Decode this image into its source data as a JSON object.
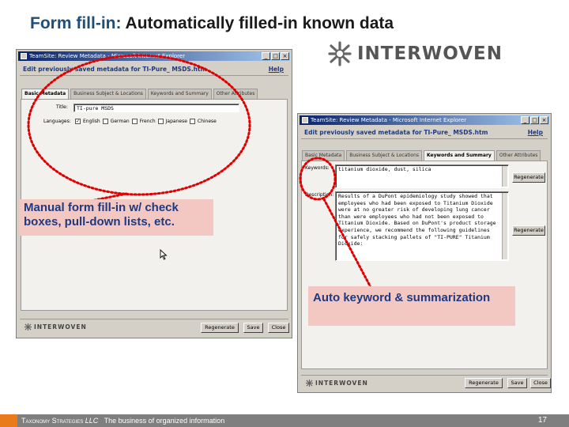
{
  "slide": {
    "title_prefix": "Form fill-in:",
    "title_main": "Automatically filled-in known data",
    "logo_text": "INTERWOVEN"
  },
  "window1": {
    "titlebar": "TeamSite: Review Metadata - Microsoft Internet Explorer",
    "header": "Edit previously saved metadata for TI-Pure_ MSDS.htm",
    "help": "Help",
    "tabs": [
      "Basic Metadata",
      "Business Subject & Locations",
      "Keywords and Summary",
      "Other Attributes"
    ],
    "title_label": "Title:",
    "title_value": "TI-pure MSDS",
    "languages_label": "Languages:",
    "languages": [
      {
        "label": "English",
        "checked": true
      },
      {
        "label": "German",
        "checked": false
      },
      {
        "label": "French",
        "checked": false
      },
      {
        "label": "Japanese",
        "checked": false
      },
      {
        "label": "Chinese",
        "checked": false
      }
    ],
    "footer_logo": "INTERWOVEN",
    "buttons": [
      "Regenerate",
      "Save",
      "Close"
    ]
  },
  "window2": {
    "titlebar": "TeamSite: Review Metadata - Microsoft Internet Explorer",
    "header": "Edit previously saved metadata for TI-Pure_ MSDS.htm",
    "help": "Help",
    "tabs": [
      "Basic Metadata",
      "Business Subject & Locations",
      "Keywords and Summary",
      "Other Attributes"
    ],
    "keywords_label": "Keywords:",
    "keywords_value": "titanium dioxide, dust, silica",
    "regenerate_1": "Regenerate",
    "description_label": "Description:",
    "description_value": "Results of a DuPont epidemiology study showed that employees who had been exposed to Titanium Dioxide were at no greater risk of developing lung cancer than were employees who had not been exposed to Titanium Dioxide. Based on DuPont's product storage experience, we recommend the following guidelines for safely stacking pallets of \"TI-PURE\" Titanium Dioxide:",
    "regenerate_2": "Regenerate",
    "footer_logo": "INTERWOVEN",
    "buttons": [
      "Regenerate",
      "Save",
      "Close"
    ]
  },
  "callouts": {
    "manual": "Manual form fill-in w/ check boxes, pull-down lists, etc.",
    "auto": "Auto keyword & summarization"
  },
  "footer": {
    "brand": "Taxonomy Strategies",
    "brand_suffix": "LLC",
    "tagline": "The business of organized information",
    "page": "17"
  },
  "colors": {
    "title_accent": "#1f4e79",
    "callout_bg": "#f3c8c2",
    "callout_text": "#1f3a80",
    "circle_red": "#e00000",
    "footer_gray": "#7f7f7f",
    "footer_orange": "#e97b1b"
  }
}
